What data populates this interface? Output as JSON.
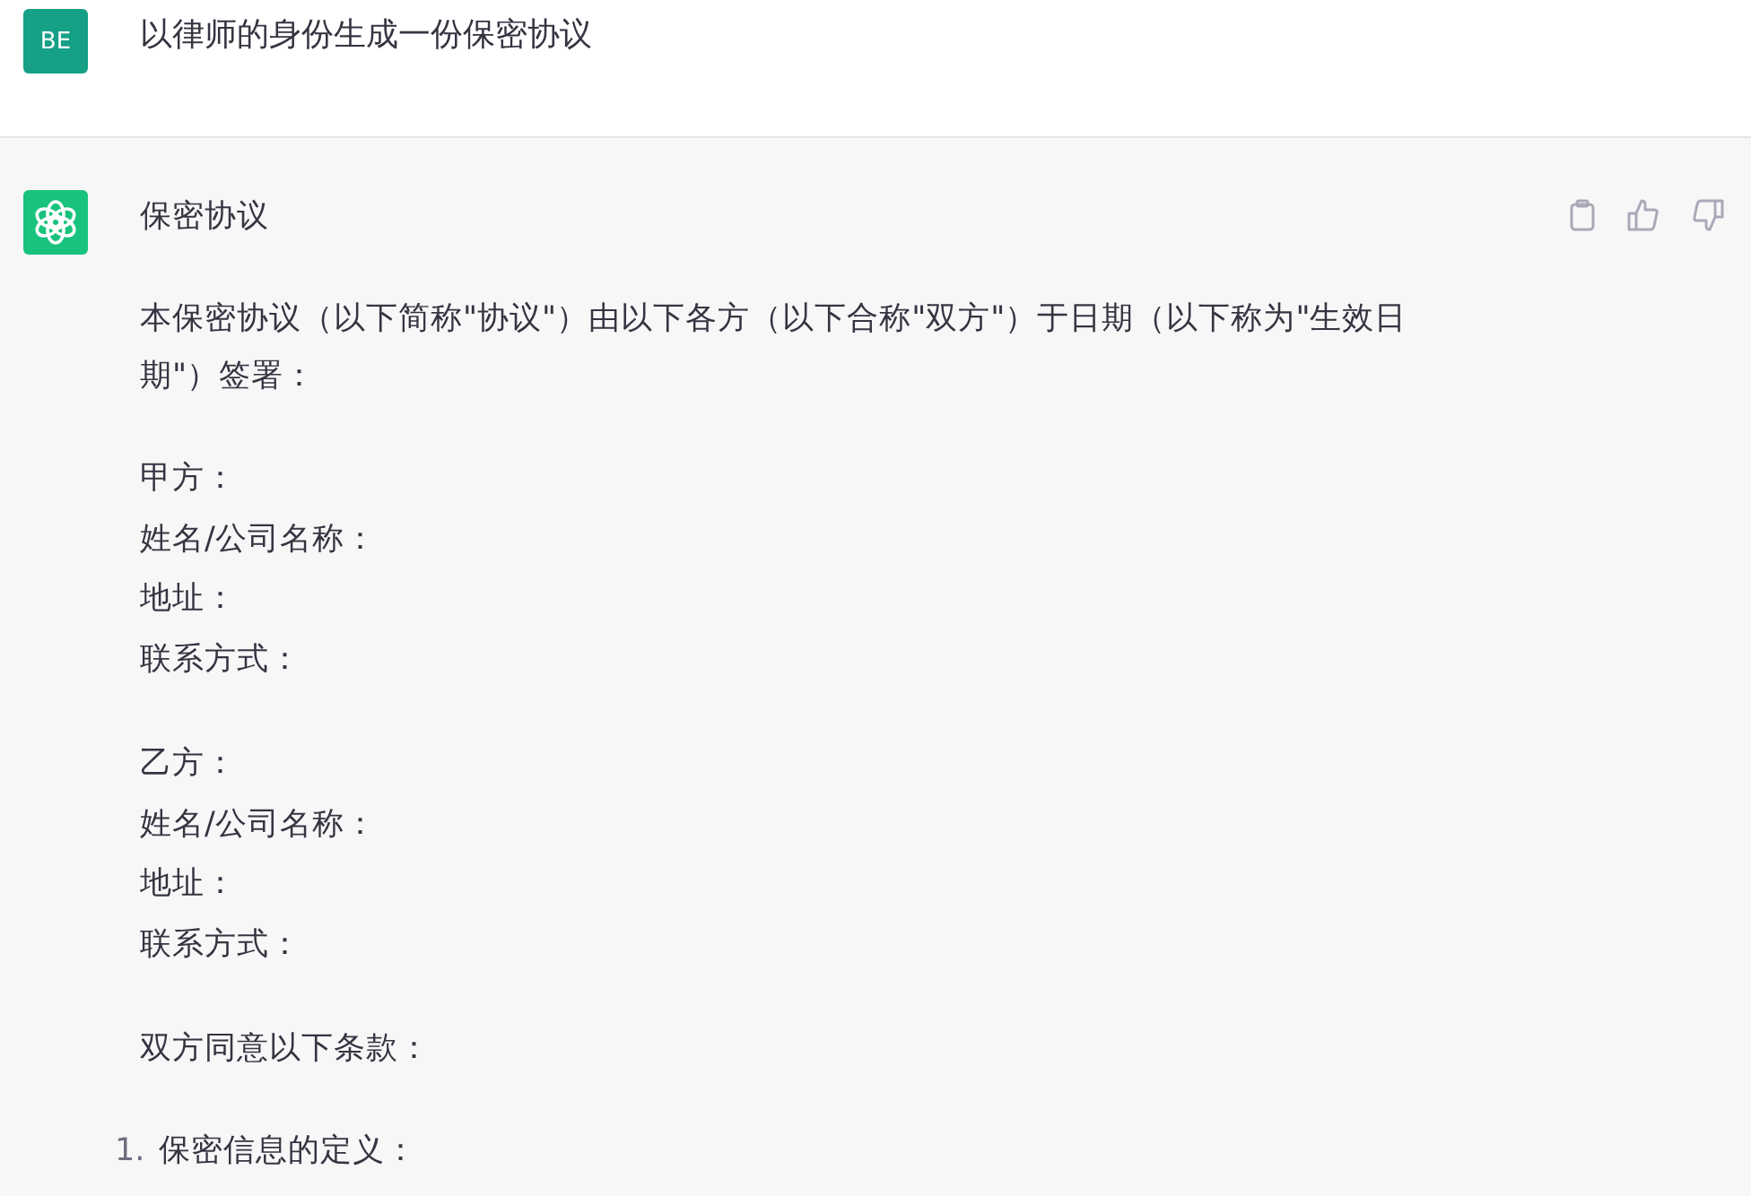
{
  "user_message": {
    "avatar": "BE",
    "text": "以律师的身份生成一份保密协议"
  },
  "assistant_message": {
    "blocks": [
      {
        "kind": "heading",
        "lines": [
          "保密协议"
        ]
      },
      {
        "kind": "paragraph",
        "lines": [
          "本保密协议（以下简称\"协议\"）由以下各方（以下合称\"双方\"）于日期（以下称为\"生效日期\"）签署："
        ]
      },
      {
        "kind": "lines",
        "lines": [
          "甲方：",
          "姓名/公司名称：",
          "地址：",
          "联系方式："
        ]
      },
      {
        "kind": "lines",
        "lines": [
          "乙方：",
          "姓名/公司名称：",
          "地址：",
          "联系方式："
        ]
      },
      {
        "kind": "paragraph",
        "lines": [
          "双方同意以下条款："
        ]
      },
      {
        "kind": "numbered",
        "items": [
          {
            "number": "1.",
            "text": "保密信息的定义："
          }
        ]
      }
    ]
  }
}
